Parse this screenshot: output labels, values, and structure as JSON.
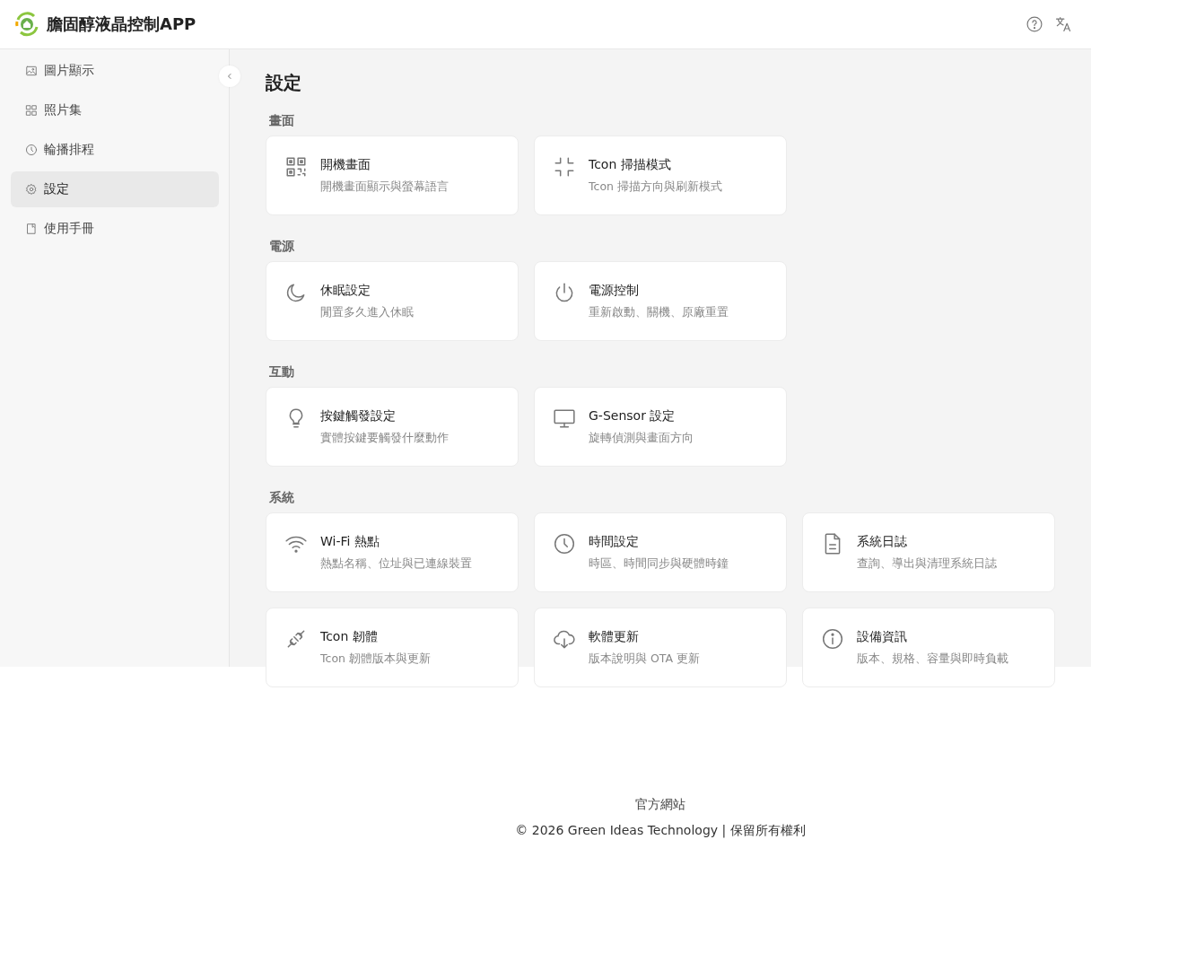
{
  "app": {
    "title": "膽固醇液晶控制APP"
  },
  "sidebar": {
    "items": [
      {
        "label": "圖片顯示",
        "selected": false
      },
      {
        "label": "照片集",
        "selected": false
      },
      {
        "label": "輪播排程",
        "selected": false
      },
      {
        "label": "設定",
        "selected": true
      },
      {
        "label": "使用手冊",
        "selected": false
      }
    ]
  },
  "page_title": "設定",
  "sections": [
    {
      "title": "畫面",
      "cards": [
        {
          "title": "開機畫面",
          "description": "開機畫面顯示與螢幕語言"
        },
        {
          "title": "Tcon 掃描模式",
          "description": "Tcon 掃描方向與刷新模式"
        }
      ]
    },
    {
      "title": "電源",
      "cards": [
        {
          "title": "休眠設定",
          "description": "閒置多久進入休眠"
        },
        {
          "title": "電源控制",
          "description": "重新啟動、關機、原廠重置"
        }
      ]
    },
    {
      "title": "互動",
      "cards": [
        {
          "title": "按鍵觸發設定",
          "description": "實體按鍵要觸發什麼動作"
        },
        {
          "title": "G-Sensor 設定",
          "description": "旋轉偵測與畫面方向"
        }
      ]
    },
    {
      "title": "系統",
      "cards": [
        {
          "title": "Wi-Fi 熱點",
          "description": "熱點名稱、位址與已連線裝置"
        },
        {
          "title": "時間設定",
          "description": "時區、時間同步與硬體時鐘"
        },
        {
          "title": "系統日誌",
          "description": "查詢、導出與清理系統日誌"
        },
        {
          "title": "Tcon 韌體",
          "description": "Tcon 韌體版本與更新"
        },
        {
          "title": "軟體更新",
          "description": "版本說明與 OTA 更新"
        },
        {
          "title": "設備資訊",
          "description": "版本、規格、容量與即時負載"
        }
      ]
    }
  ],
  "footer": {
    "link": "官方網站",
    "copyright": "© 2026 Green Ideas Technology | 保留所有權利"
  }
}
